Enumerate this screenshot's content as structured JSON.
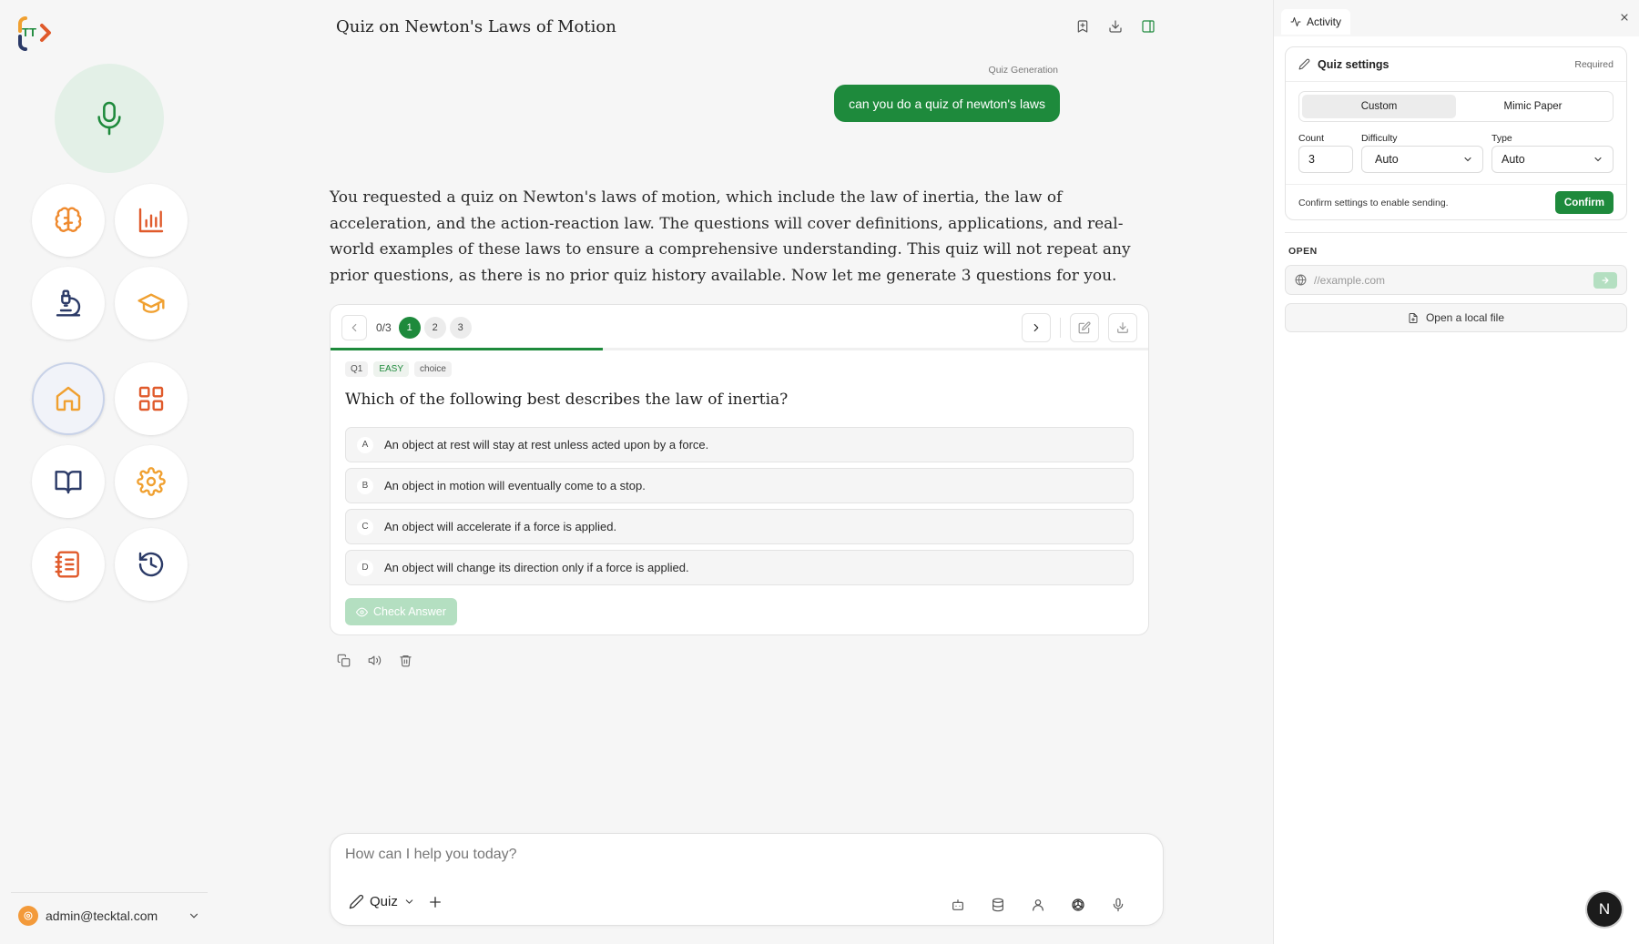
{
  "header": {
    "title": "Quiz on Newton's Laws of Motion"
  },
  "sidebar": {
    "nav": [
      {
        "name": "brain",
        "color": "#ef8a2e"
      },
      {
        "name": "chart",
        "color": "#e05a2b"
      },
      {
        "name": "microscope",
        "color": "#2b3a67"
      },
      {
        "name": "graduation-cap",
        "color": "#f0a030"
      },
      {
        "name": "home",
        "color": "#f0a030"
      },
      {
        "name": "grid",
        "color": "#e05a2b"
      },
      {
        "name": "book",
        "color": "#2b3a67"
      },
      {
        "name": "settings",
        "color": "#f0a030"
      },
      {
        "name": "notebook",
        "color": "#e05a2b"
      },
      {
        "name": "history",
        "color": "#2b3a67"
      }
    ],
    "user": {
      "email": "admin@tecktal.com"
    }
  },
  "chat": {
    "label": "Quiz Generation",
    "user_message": "can you do a quiz of newton's laws",
    "answer": "You requested a quiz on Newton's laws of motion, which include the law of inertia, the law of acceleration, and the action-reaction law. The questions will cover definitions, applications, and real-world examples of these laws to ensure a comprehensive understanding. This quiz will not repeat any prior questions, as there is no prior quiz history available. Now let me generate 3 questions for you."
  },
  "quiz": {
    "progress_text": "0/3",
    "progress_fraction": 0.333,
    "pages": [
      "1",
      "2",
      "3"
    ],
    "tags": {
      "id": "Q1",
      "difficulty": "EASY",
      "type": "choice"
    },
    "question": "Which of the following best describes the law of inertia?",
    "options": [
      {
        "letter": "A",
        "text": "An object at rest will stay at rest unless acted upon by a force."
      },
      {
        "letter": "B",
        "text": "An object in motion will eventually come to a stop."
      },
      {
        "letter": "C",
        "text": "An object will accelerate if a force is applied."
      },
      {
        "letter": "D",
        "text": "An object will change its direction only if a force is applied."
      }
    ],
    "check_label": "Check Answer"
  },
  "composer": {
    "placeholder": "How can I help you today?",
    "mode": "Quiz"
  },
  "panel": {
    "tab": "Activity",
    "settings_title": "Quiz settings",
    "required": "Required",
    "seg_custom": "Custom",
    "seg_mimic": "Mimic Paper",
    "count_label": "Count",
    "count_value": "3",
    "difficulty_label": "Difficulty",
    "difficulty_value": "Auto",
    "type_label": "Type",
    "type_value": "Auto",
    "confirm_hint": "Confirm settings to enable sending.",
    "confirm_label": "Confirm",
    "open_label": "OPEN",
    "url_placeholder": "//example.com",
    "local_file": "Open a local file"
  },
  "badge": {
    "letter": "N"
  },
  "colors": {
    "accent": "#1e8a3c",
    "accent_light": "#b4dfc1"
  }
}
